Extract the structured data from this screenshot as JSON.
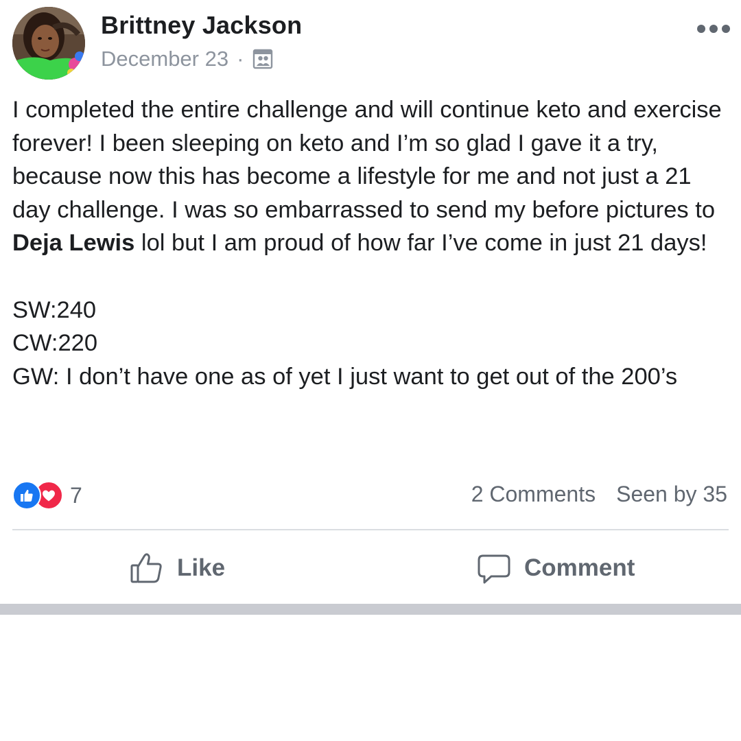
{
  "post": {
    "author": "Brittney Jackson",
    "date": "December 23",
    "date_separator": "·",
    "audience_icon": "friends-icon",
    "more_icon": "more-options-icon",
    "body_before_mention": "I completed the entire challenge and will continue keto and exercise forever! I been sleeping on keto and I’m so glad I gave it a try, because now this has become a lifestyle for me and not just a 21 day challenge. I was so embarrassed to send my before pictures to ",
    "mention": "Deja Lewis",
    "body_after_mention": " lol but I am proud of how far I’ve come in just 21 days!\n\nSW:240\nCW:220\nGW: I don’t have one as of yet I just want to get out of the 200’s"
  },
  "reactions": {
    "types": [
      "like",
      "love"
    ],
    "count": "7",
    "like_color": "#1877f2",
    "love_color": "#f02849"
  },
  "stats": {
    "comments": "2 Comments",
    "seen_by": "Seen by 35"
  },
  "actions": {
    "like_label": "Like",
    "comment_label": "Comment"
  }
}
